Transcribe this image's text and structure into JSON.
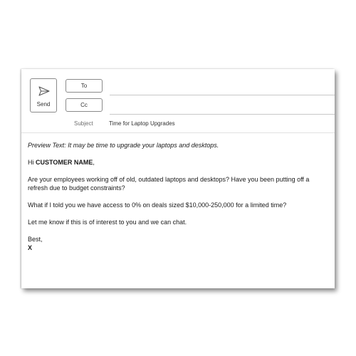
{
  "compose": {
    "send_label": "Send",
    "to_label": "To",
    "cc_label": "Cc",
    "subject_label": "Subject",
    "subject_value": "Time for Laptop Upgrades",
    "to_value": "",
    "cc_value": ""
  },
  "body": {
    "preview_text": "Preview Text: It may be time to upgrade your laptops and desktops.",
    "greeting_prefix": "Hi ",
    "customer_name": "CUSTOMER NAME",
    "greeting_suffix": ",",
    "paragraph1": "Are your employees working off of old, outdated laptops and desktops? Have you been putting off a refresh due to budget constraints?",
    "paragraph2": "What if I told you we have access to 0% on deals sized $10,000-250,000 for a limited time?",
    "paragraph3": "Let me know if this is of interest to you and we can chat.",
    "signoff": "Best,",
    "signature": "X"
  },
  "icons": {
    "send": "paper-plane-icon"
  }
}
